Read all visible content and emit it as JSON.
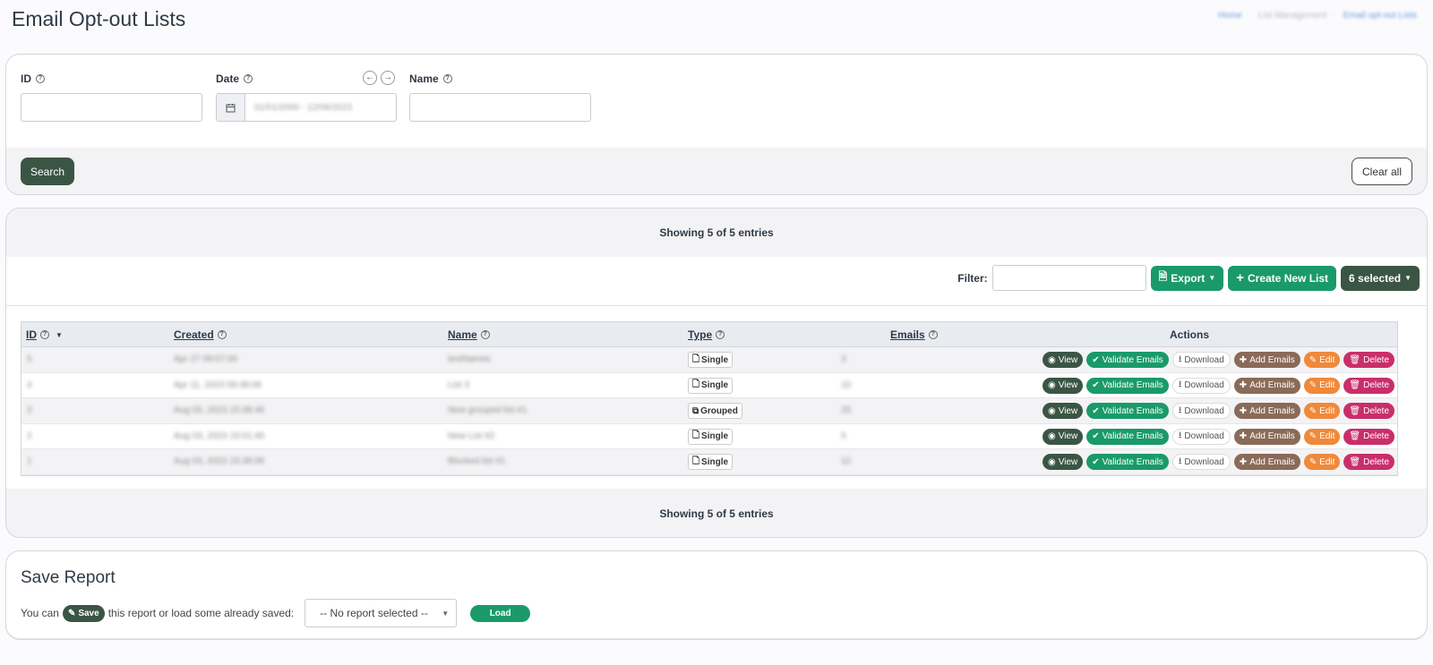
{
  "page": {
    "title": "Email Opt-out Lists",
    "breadcrumb": [
      "Home",
      "List Management",
      "Email opt-out Lists"
    ]
  },
  "search": {
    "id_label": "ID",
    "date_label": "Date",
    "name_label": "Name",
    "date_value": "01/01/2000 - 12/08/2023",
    "search_button": "Search",
    "clear_button": "Clear all"
  },
  "table": {
    "showing_top": "Showing 5 of 5 entries",
    "showing_bottom": "Showing 5 of 5 entries",
    "filter_label": "Filter:",
    "export_button": "Export",
    "create_button": "Create New List",
    "selected_button": "6 selected",
    "headers": {
      "id": "ID",
      "created": "Created",
      "name": "Name",
      "type": "Type",
      "emails": "Emails",
      "actions": "Actions"
    },
    "action_labels": {
      "view": "View",
      "validate": "Validate Emails",
      "download": "Download",
      "add": "Add Emails",
      "edit": "Edit",
      "delete": "Delete"
    },
    "rows": [
      {
        "id": "5",
        "created": "Apr 27 09:07:00",
        "name": "testNames",
        "type": "Single",
        "emails": "3"
      },
      {
        "id": "4",
        "created": "Apr 11, 2023 09:38:06",
        "name": "List 3",
        "type": "Single",
        "emails": "10"
      },
      {
        "id": "3",
        "created": "Aug 03, 2023 15:38:46",
        "name": "New grouped list #1",
        "type": "Grouped",
        "emails": "25"
      },
      {
        "id": "2",
        "created": "Aug 03, 2023 15:01:40",
        "name": "New List #2",
        "type": "Single",
        "emails": "5"
      },
      {
        "id": "1",
        "created": "Aug 03, 2023 15:38:06",
        "name": "Blocked list #1",
        "type": "Single",
        "emails": "12"
      }
    ]
  },
  "save_report": {
    "title": "Save Report",
    "prefix": "You can",
    "save_label": "Save",
    "suffix": "this report or load some already saved:",
    "select_value": "-- No report selected --",
    "load_button": "Load"
  },
  "colors": {
    "dark_green": "#3b5544",
    "green": "#1a9a6a",
    "brown": "#8a6a58",
    "orange": "#f0893a",
    "pink": "#c92e6b"
  }
}
